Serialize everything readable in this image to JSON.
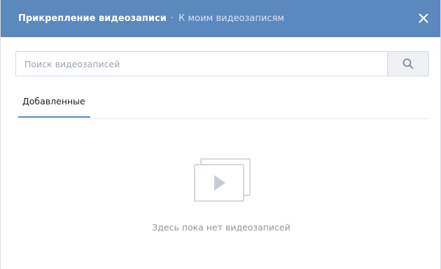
{
  "header": {
    "title": "Прикрепление видеозаписи",
    "separator": "·",
    "link": "К моим видеозаписям",
    "close_icon": "close-icon"
  },
  "search": {
    "placeholder": "Поиск видеозаписей",
    "value": "",
    "button_icon": "search-icon"
  },
  "tabs": [
    {
      "label": "Добавленные",
      "active": true
    }
  ],
  "empty_state": {
    "icon": "video-stack-icon",
    "text": "Здесь пока нет видеозаписей"
  },
  "colors": {
    "header_bg": "#5b88bd",
    "accent": "#5b88bd",
    "muted_text": "#8f959c",
    "icon_gray": "#c5ccd4"
  }
}
